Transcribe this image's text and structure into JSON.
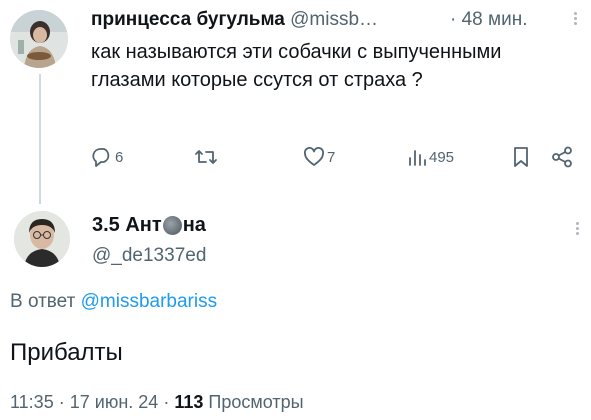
{
  "tweet1": {
    "display_name": "принцесса бугульма",
    "handle": "@missb…",
    "separator": "·",
    "time": "48 мин.",
    "text": "как называются эти собачки с выпученными глазами которые ссутся от страха ?",
    "replies": "6",
    "retweets": "",
    "likes": "7",
    "views": "495"
  },
  "tweet2": {
    "display_name_part1": "3.5 Ант",
    "display_name_part2": "на",
    "handle": "@_de1337ed",
    "reply_prefix": "В ответ",
    "reply_to": "@missbarbariss",
    "text": "Прибалты",
    "time": "11:35",
    "sep1": "·",
    "date": "17 июн. 24",
    "sep2": "·",
    "views_count": "113",
    "views_label": "Просмотры"
  },
  "colors": {
    "text": "#0f1419",
    "muted": "#536471",
    "link": "#1d9bf0",
    "thread_line": "#cfd9de"
  },
  "icons": [
    "reply-icon",
    "retweet-icon",
    "like-icon",
    "views-icon",
    "bookmark-icon",
    "share-icon",
    "more-icon",
    "moon-emoji"
  ]
}
